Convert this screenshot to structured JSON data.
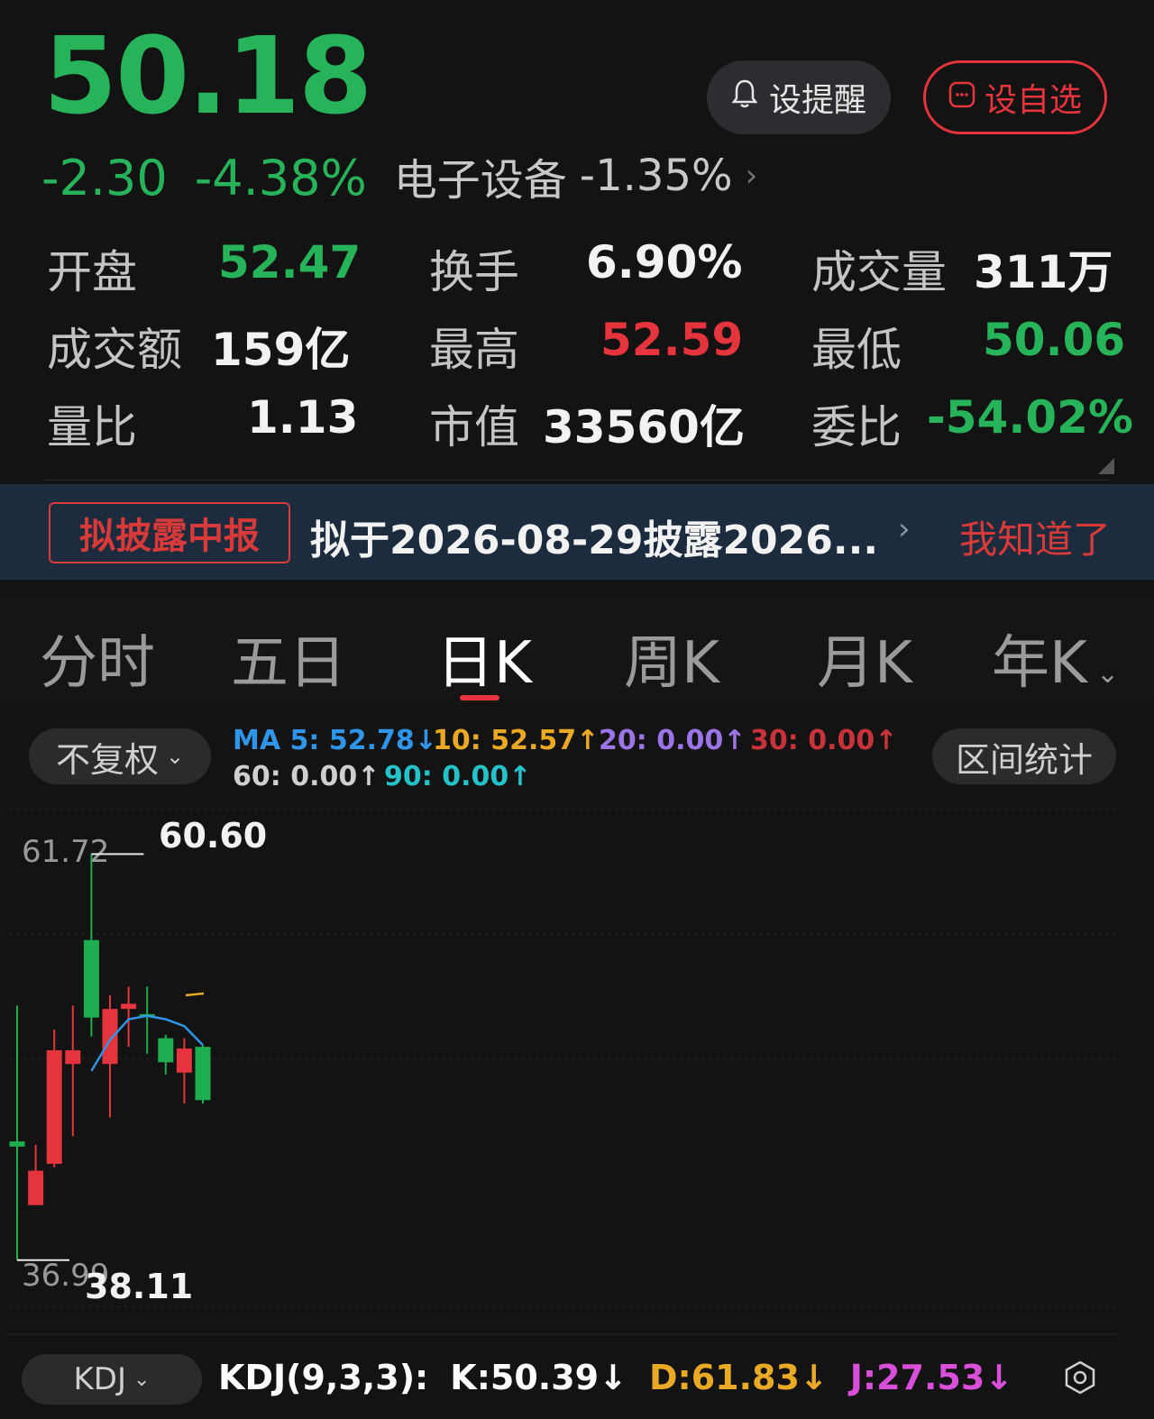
{
  "header": {
    "price": "50.18",
    "change": "-2.30",
    "change_pct": "-4.38%",
    "sector_name": "电子设备",
    "sector_change": "-1.35%",
    "alert_label": "设提醒",
    "watch_label": "设自选"
  },
  "stats": {
    "open_label": "开盘",
    "open_value": "52.47",
    "turnover_label": "换手",
    "turnover_value": "6.90%",
    "volume_label": "成交量",
    "volume_value": "311万",
    "amount_label": "成交额",
    "amount_value": "159亿",
    "high_label": "最高",
    "high_value": "52.59",
    "low_label": "最低",
    "low_value": "50.06",
    "vol_ratio_label": "量比",
    "vol_ratio_value": "1.13",
    "mkt_cap_label": "市值",
    "mkt_cap_value": "33560亿",
    "bid_ratio_label": "委比",
    "bid_ratio_value": "-54.02%"
  },
  "banner": {
    "tag": "拟披露中报",
    "text": "拟于2026-08-29披露2026...",
    "dismiss": "我知道了"
  },
  "tabs": [
    {
      "label": "分时"
    },
    {
      "label": "五日"
    },
    {
      "label": "日K"
    },
    {
      "label": "周K"
    },
    {
      "label": "月K"
    },
    {
      "label": "年K"
    }
  ],
  "toolbar": {
    "adjust_label": "不复权",
    "range_label": "区间统计"
  },
  "ma": {
    "ma5": "MA 5: 52.78↓",
    "ma10": "10: 52.57↑",
    "ma20": "20: 0.00↑",
    "ma30": "30: 0.00↑",
    "ma60": "60: 0.00↑",
    "ma90": "90: 0.00↑",
    "colors": {
      "ma5": "#2f95e8",
      "ma10": "#e9a925",
      "ma20": "#9b74e8",
      "ma30": "#c8323a",
      "ma60": "#cfcfcf",
      "ma90": "#24c2c9"
    }
  },
  "chart": {
    "axis_top": "61.72",
    "axis_bottom": "36.99",
    "max_label": "60.60",
    "min_label": "38.11"
  },
  "chart_data": {
    "type": "candlestick",
    "y_range": [
      36.99,
      61.72
    ],
    "candles": [
      {
        "open": 43.9,
        "close": 43.6,
        "high": 51.8,
        "low": 37.0
      },
      {
        "open": 40.2,
        "close": 42.2,
        "high": 43.7,
        "low": 40.2
      },
      {
        "open": 42.6,
        "close": 49.2,
        "high": 50.4,
        "low": 42.4
      },
      {
        "open": 48.4,
        "close": 49.2,
        "high": 51.8,
        "low": 44.2
      },
      {
        "open": 55.6,
        "close": 51.1,
        "high": 60.6,
        "low": 50.0
      },
      {
        "open": 48.4,
        "close": 51.6,
        "high": 52.4,
        "low": 45.3
      },
      {
        "open": 51.6,
        "close": 51.9,
        "high": 52.9,
        "low": 49.4
      },
      {
        "open": 51.3,
        "close": 51.2,
        "high": 52.9,
        "low": 49.0
      },
      {
        "open": 49.9,
        "close": 48.5,
        "high": 50.1,
        "low": 47.8
      },
      {
        "open": 47.9,
        "close": 49.3,
        "high": 49.9,
        "low": 46.1
      },
      {
        "open": 49.4,
        "close": 46.3,
        "high": 49.5,
        "low": 46.1
      }
    ],
    "ma5_points": [
      [
        4,
        48.0
      ],
      [
        5,
        49.8
      ],
      [
        6,
        51.0
      ],
      [
        7,
        51.2
      ],
      [
        8,
        51.0
      ],
      [
        9,
        50.6
      ],
      [
        10,
        49.5
      ]
    ]
  },
  "kdj": {
    "selector": "KDJ",
    "params": "KDJ(9,3,3):",
    "k": "K:50.39↓",
    "d": "D:61.83↓",
    "j": "J:27.53↓",
    "k_color": "#ffffff",
    "d_color": "#e9a925",
    "j_color": "#d94fd9"
  }
}
